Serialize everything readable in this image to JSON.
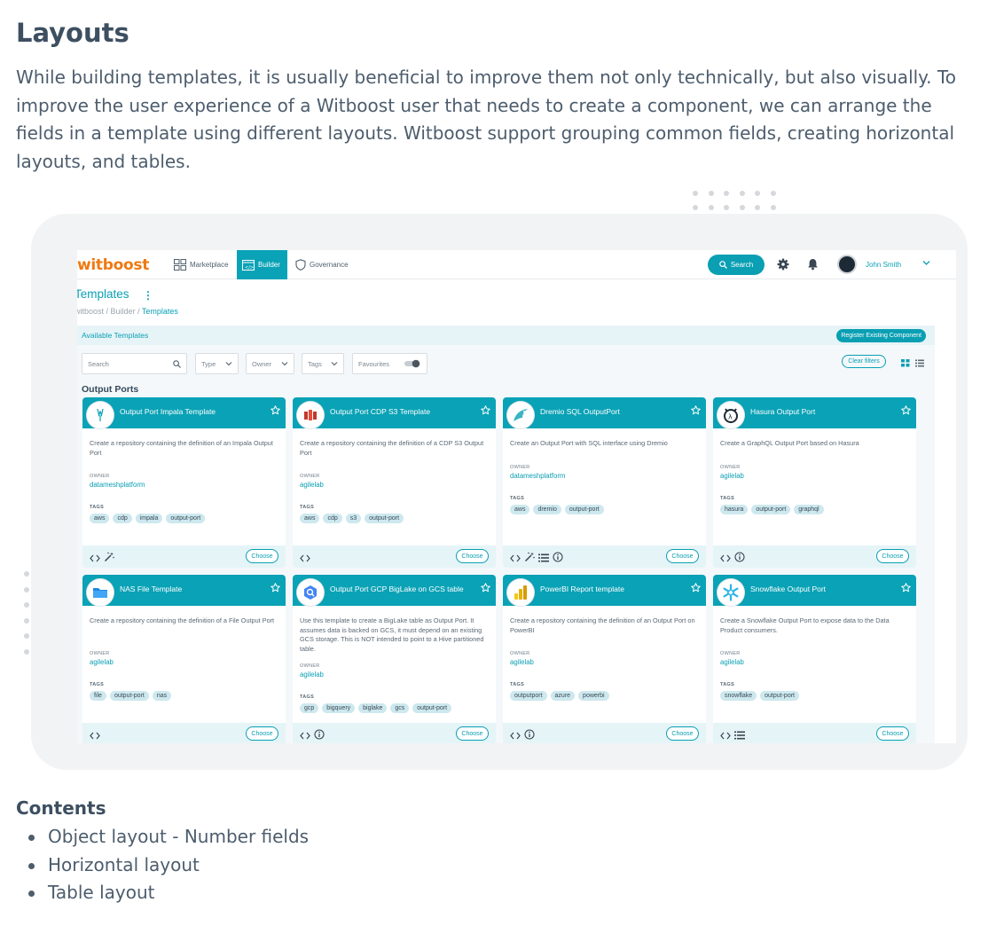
{
  "doc": {
    "title": "Layouts",
    "paragraph": "While building templates, it is usually beneficial to improve them not only technically, but also visually. To improve the user experience of a Witboost user that needs to create a component, we can arrange the fields in a template using different layouts. Witboost support grouping common fields, creating horizontal layouts, and tables.",
    "contents_title": "Contents",
    "contents": [
      "Object layout - Number fields",
      "Horizontal layout",
      "Table layout"
    ]
  },
  "app": {
    "logo": "witboost",
    "nav": [
      {
        "label": "Marketplace",
        "icon": "marketplace-icon"
      },
      {
        "label": "Builder",
        "icon": "builder-icon",
        "active": true
      },
      {
        "label": "Governance",
        "icon": "shield-icon"
      }
    ],
    "search_label": "Search",
    "user_name": "John Smith",
    "page_title": "Templates",
    "breadcrumbs": [
      "witboost",
      "Builder",
      "Templates"
    ],
    "available_label": "Available Templates",
    "register_label": "Register Existing Component",
    "filters": {
      "search_placeholder": "Search",
      "type": "Type",
      "owner": "Owner",
      "tags": "Tags",
      "favourites": "Favourites",
      "clear": "Clear filters"
    },
    "section_title": "Output Ports",
    "owner_label": "OWNER",
    "tags_label": "TAGS",
    "choose_label": "Choose",
    "accent": "#0aa2b6",
    "logo_color": "#ee7a12"
  },
  "cards": [
    {
      "title": "Output Port Impala Template",
      "icon": "impala-icon",
      "desc": "Create a repository containing the definition of an Impala Output Port",
      "owner": "datameshplatform",
      "tags": [
        "aws",
        "cdp",
        "impala",
        "output-port"
      ],
      "foot_icons": [
        "code-icon",
        "wand-icon"
      ]
    },
    {
      "title": "Output Port CDP S3 Template",
      "icon": "s3-icon",
      "desc": "Create a repository containing the definition of a CDP S3 Output Port",
      "owner": "agilelab",
      "tags": [
        "aws",
        "cdp",
        "s3",
        "output-port"
      ],
      "foot_icons": [
        "code-icon"
      ]
    },
    {
      "title": "Dremio SQL OutputPort",
      "icon": "dremio-icon",
      "desc": "Create an Output Port with SQL interface using Dremio",
      "owner": "datameshplatform",
      "tags": [
        "aws",
        "dremio",
        "output-port"
      ],
      "foot_icons": [
        "code-icon",
        "wand-icon",
        "list-icon",
        "info-icon"
      ]
    },
    {
      "title": "Hasura Output Port",
      "icon": "hasura-icon",
      "desc": "Create a GraphQL Output Port based on Hasura",
      "owner": "agilelab",
      "tags": [
        "hasura",
        "output-port",
        "graphql"
      ],
      "foot_icons": [
        "code-icon",
        "info-icon"
      ]
    },
    {
      "title": "NAS File Template",
      "icon": "folder-icon",
      "desc": "Create a repository containing the definition of a File Output Port",
      "owner": "agilelab",
      "tags": [
        "file",
        "output-port",
        "nas"
      ],
      "foot_icons": [
        "code-icon"
      ]
    },
    {
      "title": "Output Port GCP BigLake on GCS table",
      "icon": "biglake-icon",
      "desc": "Use this template to create a BigLake table as Output Port. It assumes data is backed on GCS, it must depend on an existing GCS storage. This is NOT intended to point to a Hive partitioned table.",
      "owner": "agilelab",
      "tags": [
        "gcp",
        "bigquery",
        "biglake",
        "gcs",
        "output-port"
      ],
      "foot_icons": [
        "code-icon",
        "info-icon"
      ]
    },
    {
      "title": "PowerBI Report template",
      "icon": "powerbi-icon",
      "desc": "Create a repository containing the definition of an Output Port on PowerBI",
      "owner": "agilelab",
      "tags": [
        "outputport",
        "azure",
        "powerbi"
      ],
      "foot_icons": [
        "code-icon",
        "info-icon"
      ]
    },
    {
      "title": "Snowflake Output Port",
      "icon": "snowflake-icon",
      "desc": "Create a Snowflake Output Port to expose data to the Data Product consumers.",
      "owner": "agilelab",
      "tags": [
        "snowflake",
        "output-port"
      ],
      "foot_icons": [
        "code-icon",
        "list-icon"
      ]
    }
  ]
}
